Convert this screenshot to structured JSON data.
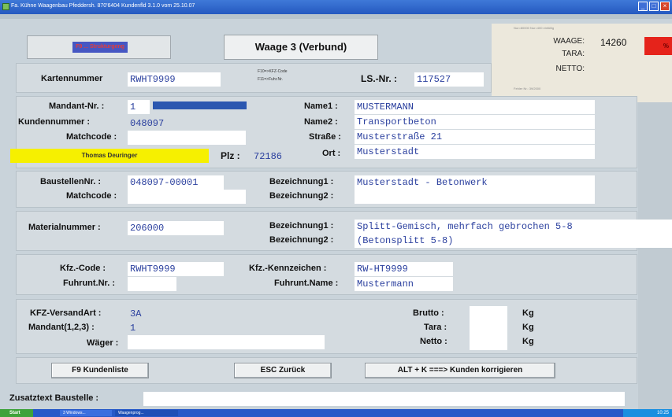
{
  "window": {
    "title": "Fa. Kühne Waagenbau  Pfeddersh.  870'6404   Kundenfld 3.1.0  vom 25.10.07"
  },
  "header": {
    "status_button": "F9  ...  Strukturgeng",
    "waage_title": "Waage 3 (Verbund)",
    "info_line1": "F10=>KFZ-Code",
    "info_line2": "F11=>Fuhr.Nr."
  },
  "scale": {
    "top_text": "Nur=80000 Nur=400 einfüllig",
    "waage_label": "WAAGE:",
    "tara_label": "TARA:",
    "netto_label": "NETTO:",
    "waage_value": "14260",
    "indicator": "%",
    "bottom_text": "Fehler Nr.: 39/2000"
  },
  "karte": {
    "kartennummer_label": "Kartennummer",
    "kartennummer_value": "RWHT9999",
    "ls_label": "LS.-Nr. :",
    "ls_value": "117527"
  },
  "kunde": {
    "mandant_label": "Mandant-Nr. :",
    "mandant_value": "1",
    "kundennummer_label": "Kundennummer :",
    "kundennummer_value": "048097",
    "matchcode_label": "Matchcode :",
    "matchcode_value": "",
    "person": "Thomas Deuringer",
    "plz_label": "Plz :",
    "plz_value": "72186",
    "name1_label": "Name1 :",
    "name1_value": "MUSTERMANN",
    "name2_label": "Name2 :",
    "name2_value": "Transportbeton",
    "strasse_label": "Straße :",
    "strasse_value": "Musterstraße 21",
    "ort_label": "Ort :",
    "ort_value": "Musterstadt"
  },
  "baustelle": {
    "nr_label": "BaustellenNr. :",
    "nr_value": "048097-00001",
    "matchcode_label": "Matchcode :",
    "matchcode_value": "",
    "bez1_label": "Bezeichnung1 :",
    "bez1_value": "Musterstadt - Betonwerk",
    "bez2_label": "Bezeichnung2 :",
    "bez2_value": ""
  },
  "material": {
    "nr_label": "Materialnummer :",
    "nr_value": "206000",
    "bez1_label": "Bezeichnung1 :",
    "bez1_value": "Splitt-Gemisch, mehrfach gebrochen 5-8",
    "bez2_label": "Bezeichnung2 :",
    "bez2_value": "(Betonsplitt    5-8)"
  },
  "fahrzeug": {
    "code_label": "Kfz.-Code :",
    "code_value": "RWHT9999",
    "fuhr_nr_label": "Fuhrunt.Nr. :",
    "fuhr_nr_value": "",
    "kennz_label": "Kfz.-Kennzeichen :",
    "kennz_value": "RW-HT9999",
    "fuhr_name_label": "Fuhrunt.Name :",
    "fuhr_name_value": "Mustermann"
  },
  "versand": {
    "art_label": "KFZ-VersandArt :",
    "art_value": "3A",
    "mandant_label": "Mandant(1,2,3) :",
    "mandant_value": "1",
    "waeger_label": "Wäger :",
    "waeger_value": "",
    "brutto_label": "Brutto :",
    "tara_label": "Tara :",
    "netto_label": "Netto :",
    "unit": "Kg"
  },
  "buttons": {
    "kundenliste": "F9 Kundenliste",
    "zurueck": "ESC Zurück",
    "korrigieren": "ALT + K ===> Kunden korrigieren"
  },
  "zusatz": {
    "label": "Zusatztext Baustelle :",
    "value": ""
  },
  "taskbar": {
    "start": "Start",
    "item1": "3 Windows...",
    "item2": "Waagenprog...",
    "clock": "10:25"
  }
}
